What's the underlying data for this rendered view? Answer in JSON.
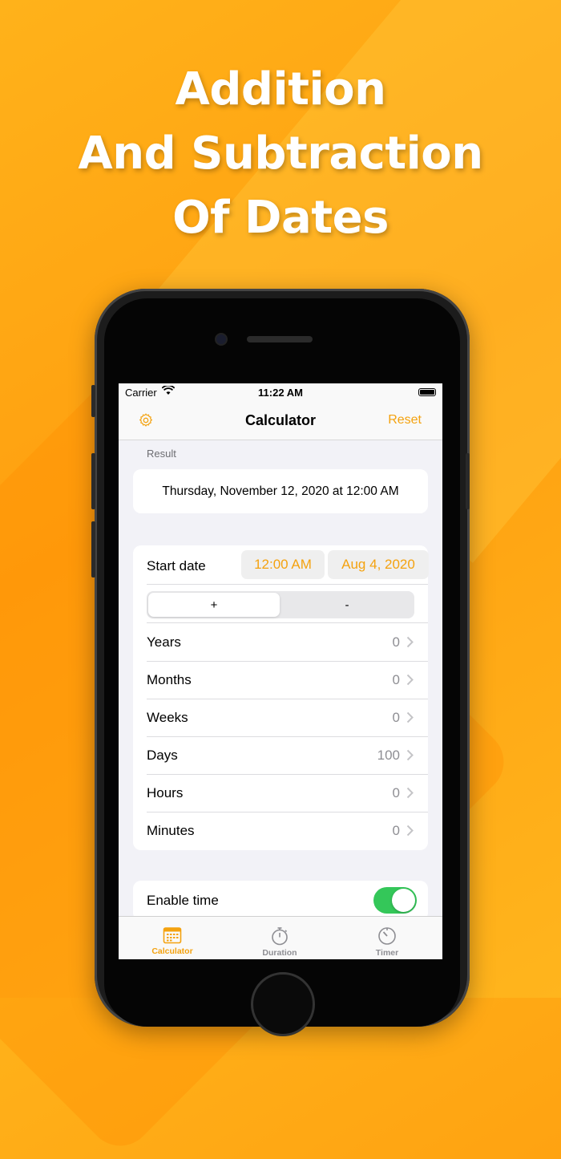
{
  "promo": {
    "line1": "Addition",
    "line2": "And Subtraction",
    "line3": "Of Dates"
  },
  "statusbar": {
    "carrier": "Carrier",
    "time": "11:22 AM"
  },
  "navbar": {
    "title": "Calculator",
    "reset_label": "Reset",
    "settings_icon": "gear-icon"
  },
  "result": {
    "section_label": "Result",
    "value": "Thursday, November 12, 2020 at 12:00 AM"
  },
  "calculator": {
    "start_date_label": "Start date",
    "start_time": "12:00 AM",
    "start_date": "Aug 4, 2020",
    "operation": {
      "plus": "+",
      "minus": "-",
      "selected": "+"
    },
    "fields": [
      {
        "label": "Years",
        "value": "0"
      },
      {
        "label": "Months",
        "value": "0"
      },
      {
        "label": "Weeks",
        "value": "0"
      },
      {
        "label": "Days",
        "value": "100"
      },
      {
        "label": "Hours",
        "value": "0"
      },
      {
        "label": "Minutes",
        "value": "0"
      }
    ]
  },
  "enable_time": {
    "label": "Enable time",
    "on": true
  },
  "tabbar": {
    "tabs": [
      {
        "label": "Calculator",
        "icon": "calendar-icon",
        "active": true
      },
      {
        "label": "Duration",
        "icon": "stopwatch-icon",
        "active": false
      },
      {
        "label": "Timer",
        "icon": "timer-icon",
        "active": false
      }
    ]
  },
  "colors": {
    "accent": "#f4a20f",
    "background": "#ffa514",
    "toggle_on": "#34c759"
  }
}
